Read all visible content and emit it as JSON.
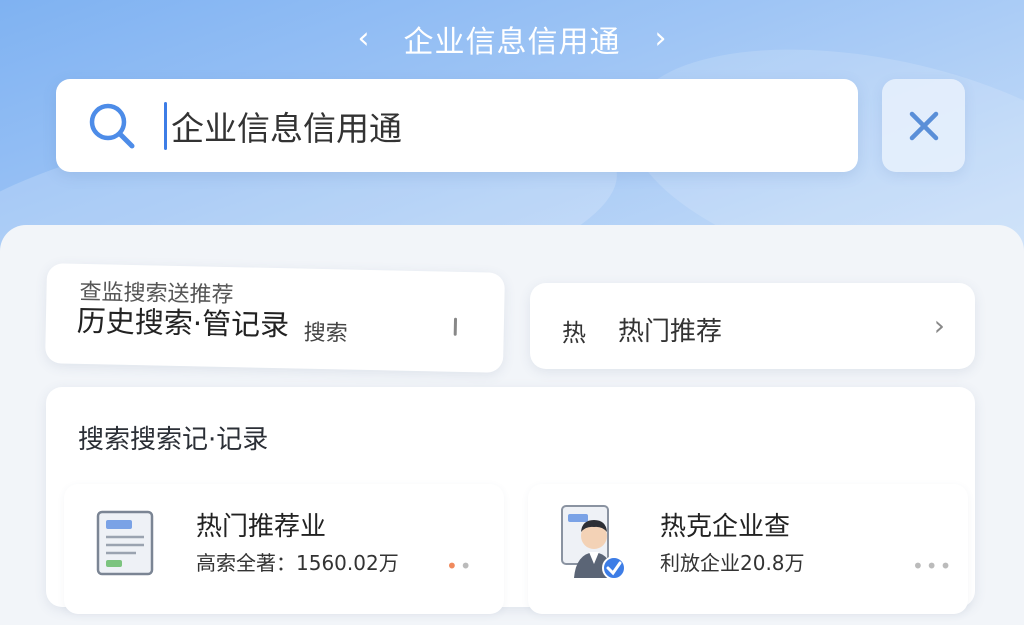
{
  "header": {
    "title": "企业信息信用通",
    "back_icon": "chevron-left-icon",
    "forward_icon": "chevron-right-icon"
  },
  "search": {
    "value": "企业信息信用通",
    "icon": "search-icon",
    "close_icon": "close-icon"
  },
  "history_card": {
    "ghost_text": "查监搜索送推荐",
    "title": "历史搜索·管记录",
    "action": "搜索",
    "bar": "|"
  },
  "hot_card": {
    "icon_text": "热",
    "label": "热门推荐",
    "arrow": "›"
  },
  "records": {
    "title": "搜索搜索记·记录",
    "items": [
      {
        "name": "热门推荐业",
        "meta": "高索全著：1560.02万",
        "icon": "document-icon"
      },
      {
        "name": "热克企业查",
        "meta": "利放企业20.8万",
        "icon": "verified-person-icon"
      }
    ],
    "more_icon": "more-dots-icon"
  },
  "colors": {
    "accent": "#3d7de6",
    "background_top": "#7fb2f2",
    "panel": "#f2f5f9"
  }
}
